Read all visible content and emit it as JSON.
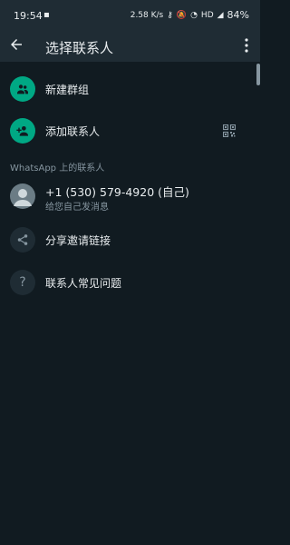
{
  "status_bar": {
    "time": "19:54",
    "speed": "2.58 K/s",
    "network": "HD",
    "battery": "84%"
  },
  "header": {
    "title": "选择联系人"
  },
  "actions": {
    "new_group": "新建群组",
    "add_contact": "添加联系人"
  },
  "section_header": "WhatsApp 上的联系人",
  "contacts": [
    {
      "name": "+1 (530) 579-4920 (自己)",
      "status": "给您自己发消息"
    }
  ],
  "extra": {
    "share_invite": "分享邀请链接",
    "contact_faq": "联系人常见问题"
  },
  "colors": {
    "background": "#111b21",
    "header": "#1f2c34",
    "accent": "#00a884",
    "secondary_text": "#8696a0"
  }
}
